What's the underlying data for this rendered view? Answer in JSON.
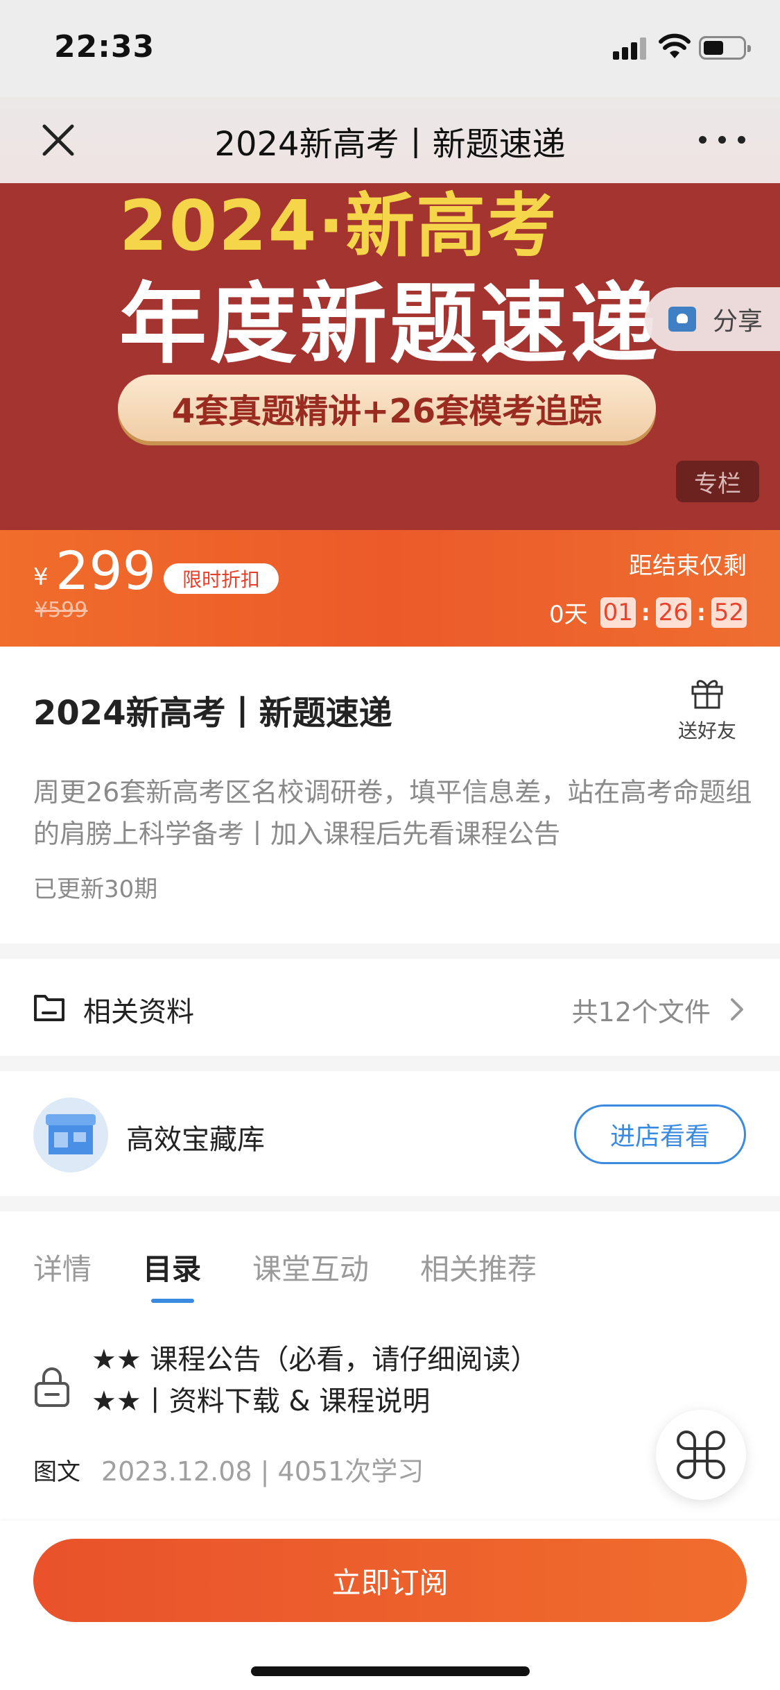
{
  "status_bar": {
    "time": "22:33"
  },
  "nav": {
    "title": "2024新高考丨新题速递"
  },
  "banner": {
    "year_text": "2024·新高考",
    "headline": "年度新题速递",
    "pill_text": "4套真题精讲+26套模考追踪",
    "share_label": "分享",
    "column_tag": "专栏"
  },
  "price": {
    "currency": "¥",
    "current": "299",
    "discount_badge": "限时折扣",
    "original": "¥599",
    "countdown_label": "距结束仅剩",
    "days": "0天",
    "hours": "01",
    "minutes": "26",
    "seconds": "52"
  },
  "course": {
    "title": "2024新高考丨新题速递",
    "gift_label": "送好友",
    "description": "周更26套新高考区名校调研卷，填平信息差，站在高考命题组的肩膀上科学备考丨加入课程后先看课程公告",
    "update_count": "已更新30期"
  },
  "materials": {
    "label": "相关资料",
    "count": "共12个文件"
  },
  "store": {
    "name": "高效宝藏库",
    "button_label": "进店看看"
  },
  "tabs": [
    {
      "label": "详情"
    },
    {
      "label": "目录"
    },
    {
      "label": "课堂互动"
    },
    {
      "label": "相关推荐"
    }
  ],
  "active_tab": "目录",
  "lesson": {
    "title_line1": "★★ 课程公告（必看，请仔细阅读）",
    "title_line2": "★★丨资料下载 & 课程说明",
    "type": "图文",
    "meta": "2023.12.08 | 4051次学习"
  },
  "bottom": {
    "subscribe_label": "立即订阅"
  },
  "colors": {
    "accent_orange": "#ec5a2a",
    "banner_red": "#a4342f",
    "link_blue": "#3a8ae0",
    "headline_yellow": "#f5d64a"
  }
}
